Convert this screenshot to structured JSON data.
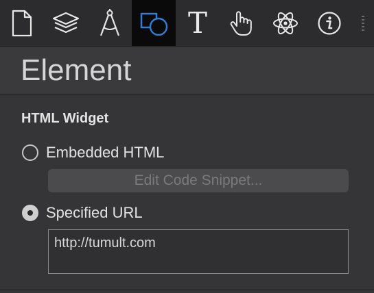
{
  "toolbar": {
    "tools": [
      {
        "name": "document-icon",
        "active": false
      },
      {
        "name": "layers-icon",
        "active": false
      },
      {
        "name": "compass-icon",
        "active": false
      },
      {
        "name": "shapes-icon",
        "active": true
      },
      {
        "name": "text-icon",
        "active": false,
        "glyph": "T"
      },
      {
        "name": "hand-pointer-icon",
        "active": false
      },
      {
        "name": "atom-icon",
        "active": false
      },
      {
        "name": "info-icon",
        "active": false
      }
    ],
    "accent_color": "#2f7fd8"
  },
  "header": {
    "title": "Element"
  },
  "section": {
    "title": "HTML Widget",
    "options": [
      {
        "label": "Embedded HTML",
        "selected": false
      },
      {
        "label": "Specified URL",
        "selected": true
      }
    ],
    "edit_button_label": "Edit Code Snippet...",
    "url_value": "http://tumult.com"
  }
}
